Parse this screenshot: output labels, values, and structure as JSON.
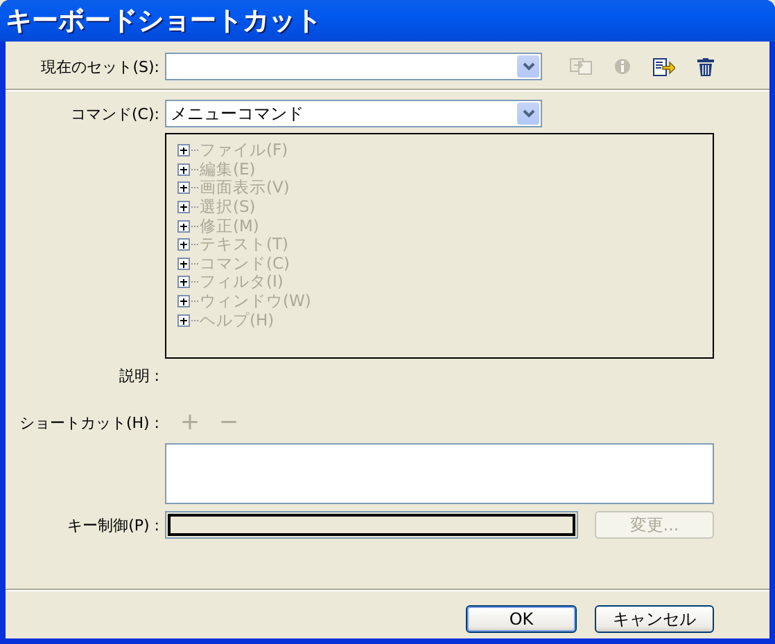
{
  "window": {
    "title": "キーボードショートカット"
  },
  "current_set": {
    "label": "現在のセット(S):"
  },
  "set_tools": [
    {
      "kind": "duplicate",
      "disabled": true
    },
    {
      "kind": "info",
      "disabled": true
    },
    {
      "kind": "export",
      "disabled": false
    },
    {
      "kind": "delete",
      "disabled": false
    }
  ],
  "command": {
    "label": "コマンド(C):",
    "value": "メニューコマンド"
  },
  "tree": {
    "disabled": true,
    "items": [
      {
        "label": "ファイル(F)",
        "expanded": false
      },
      {
        "label": "編集(E)",
        "expanded": false
      },
      {
        "label": "画面表示(V)",
        "expanded": false
      },
      {
        "label": "選択(S)",
        "expanded": false
      },
      {
        "label": "修正(M)",
        "expanded": false
      },
      {
        "label": "テキスト(T)",
        "expanded": false
      },
      {
        "label": "コマンド(C)",
        "expanded": false
      },
      {
        "label": "フィルタ(I)",
        "expanded": false
      },
      {
        "label": "ウィンドウ(W)",
        "expanded": false
      },
      {
        "label": "ヘルプ(H)",
        "expanded": false
      }
    ]
  },
  "description": {
    "label": "説明 :"
  },
  "shortcut": {
    "label": "ショートカット(H) :",
    "add": {
      "text": "+",
      "disabled": true
    },
    "remove": {
      "text": "−",
      "disabled": true
    }
  },
  "key_control": {
    "label": "キー制御(P) :",
    "change_button": {
      "text": "変更...",
      "disabled": true
    }
  },
  "buttons": [
    {
      "text": "OK",
      "default": true
    },
    {
      "text": "キャンセル",
      "default": false
    }
  ]
}
